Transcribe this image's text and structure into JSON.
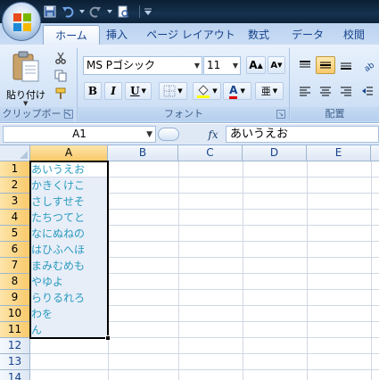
{
  "quick_access": {
    "items": [
      "save-icon",
      "undo-icon",
      "redo-icon",
      "print-preview-icon",
      "customize-icon"
    ]
  },
  "tabs": [
    {
      "label": "ホーム",
      "active": true
    },
    {
      "label": "挿入"
    },
    {
      "label": "ページ レイアウト"
    },
    {
      "label": "数式"
    },
    {
      "label": "データ"
    },
    {
      "label": "校閲"
    }
  ],
  "ribbon": {
    "clipboard": {
      "paste_label": "貼り付け",
      "group_label": "クリップボード"
    },
    "font": {
      "name": "MS Pゴシック",
      "size": "11",
      "group_label": "フォント",
      "bold": "B",
      "italic": "I",
      "underline": "U",
      "font_color_letter": "A",
      "phonetic_letter": "亜"
    },
    "alignment": {
      "group_label": "配置"
    }
  },
  "formula_bar": {
    "name_box": "A1",
    "fx_label": "fx",
    "content": "あいうえお"
  },
  "sheet": {
    "columns": [
      "A",
      "B",
      "C",
      "D",
      "E"
    ],
    "selected_column": "A",
    "rows": [
      "1",
      "2",
      "3",
      "4",
      "5",
      "6",
      "7",
      "8",
      "9",
      "10",
      "11",
      "12",
      "13",
      "14"
    ],
    "selected_rows": [
      "1",
      "2",
      "3",
      "4",
      "5",
      "6",
      "7",
      "8",
      "9",
      "10",
      "11"
    ],
    "column_a_values": [
      "あいうえお",
      "かきくけこ",
      "さしすせそ",
      "たちつてと",
      "なにぬねの",
      "はひふへほ",
      "まみむめも",
      "やゆよ",
      "らりるれろ",
      "わを",
      "ん"
    ],
    "active_cell": "A1",
    "selection": "A1:A11"
  },
  "colors": {
    "cell_text": "#2a9bbf",
    "accent": "#15428b",
    "header_selected": "#f9c96b"
  }
}
